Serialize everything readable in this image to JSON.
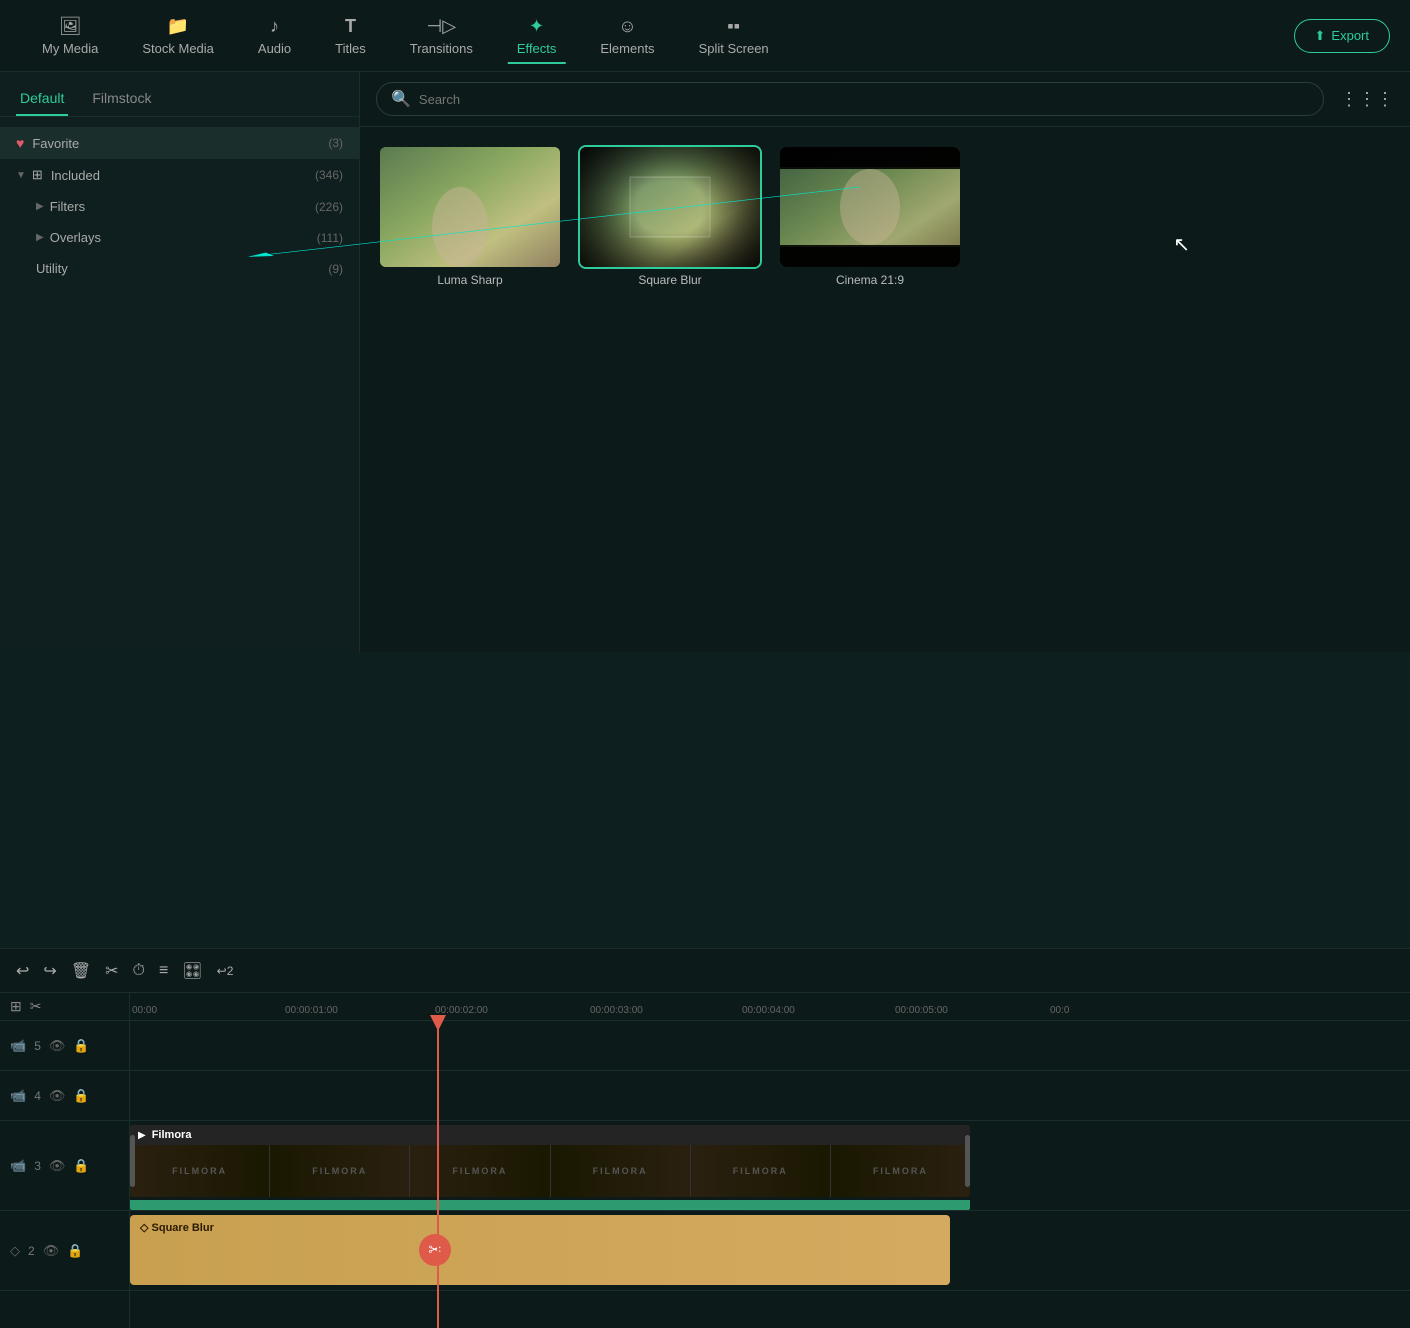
{
  "nav": {
    "items": [
      {
        "id": "my-media",
        "label": "My Media",
        "icon": "🖼",
        "active": false
      },
      {
        "id": "stock-media",
        "label": "Stock Media",
        "icon": "📁",
        "active": false
      },
      {
        "id": "audio",
        "label": "Audio",
        "icon": "🎵",
        "active": false
      },
      {
        "id": "titles",
        "label": "Titles",
        "icon": "T",
        "active": false
      },
      {
        "id": "transitions",
        "label": "Transitions",
        "icon": "⏭",
        "active": false
      },
      {
        "id": "effects",
        "label": "Effects",
        "icon": "✦",
        "active": true
      },
      {
        "id": "elements",
        "label": "Elements",
        "icon": "🙂",
        "active": false
      },
      {
        "id": "split-screen",
        "label": "Split Screen",
        "icon": "⬛",
        "active": false
      }
    ],
    "export_label": "Export"
  },
  "panel": {
    "tabs": [
      {
        "id": "default",
        "label": "Default",
        "active": true
      },
      {
        "id": "filmstock",
        "label": "Filmstock",
        "active": false
      }
    ],
    "search_placeholder": "Search",
    "tree": [
      {
        "id": "favorite",
        "label": "Favorite",
        "count": "(3)",
        "icon": "♥",
        "active": true,
        "indent": 0
      },
      {
        "id": "included",
        "label": "Included",
        "count": "(346)",
        "icon": "grid",
        "active": false,
        "indent": 0,
        "expanded": true
      },
      {
        "id": "filters",
        "label": "Filters",
        "count": "(226)",
        "icon": null,
        "active": false,
        "indent": 1
      },
      {
        "id": "overlays",
        "label": "Overlays",
        "count": "(111)",
        "icon": null,
        "active": false,
        "indent": 1
      },
      {
        "id": "utility",
        "label": "Utility",
        "count": "(9)",
        "icon": null,
        "active": false,
        "indent": 1
      }
    ]
  },
  "effects": [
    {
      "id": "luma-sharp",
      "label": "Luma Sharp",
      "selected": false
    },
    {
      "id": "square-blur",
      "label": "Square Blur",
      "selected": true
    },
    {
      "id": "cinema-21-9",
      "label": "Cinema 21:9",
      "selected": false
    }
  ],
  "timeline": {
    "toolbar_buttons": [
      "↩",
      "↪",
      "🗑",
      "✂",
      "⏱",
      "≡",
      "🎛",
      "↩"
    ],
    "ruler_marks": [
      "00:00",
      "00:00:01:00",
      "00:00:02:00",
      "00:00:03:00",
      "00:00:04:00",
      "00:00:05:00",
      "00:0"
    ],
    "tracks": [
      {
        "number": "5",
        "icons": [
          "📹",
          "👁",
          "🔒"
        ]
      },
      {
        "number": "4",
        "icons": [
          "📹",
          "👁",
          "🔒"
        ]
      },
      {
        "number": "3",
        "icons": [
          "📹",
          "👁",
          "🔒"
        ]
      },
      {
        "number": "2",
        "icons": [
          "◇",
          "👁",
          "🔒"
        ]
      }
    ],
    "clips": [
      {
        "type": "filmora",
        "label": "Filmora",
        "track": 3
      },
      {
        "type": "green",
        "track": 3
      },
      {
        "type": "square-blur",
        "label": "Square Blur",
        "track": 2
      }
    ],
    "playhead_position": "00:00:02:00"
  }
}
